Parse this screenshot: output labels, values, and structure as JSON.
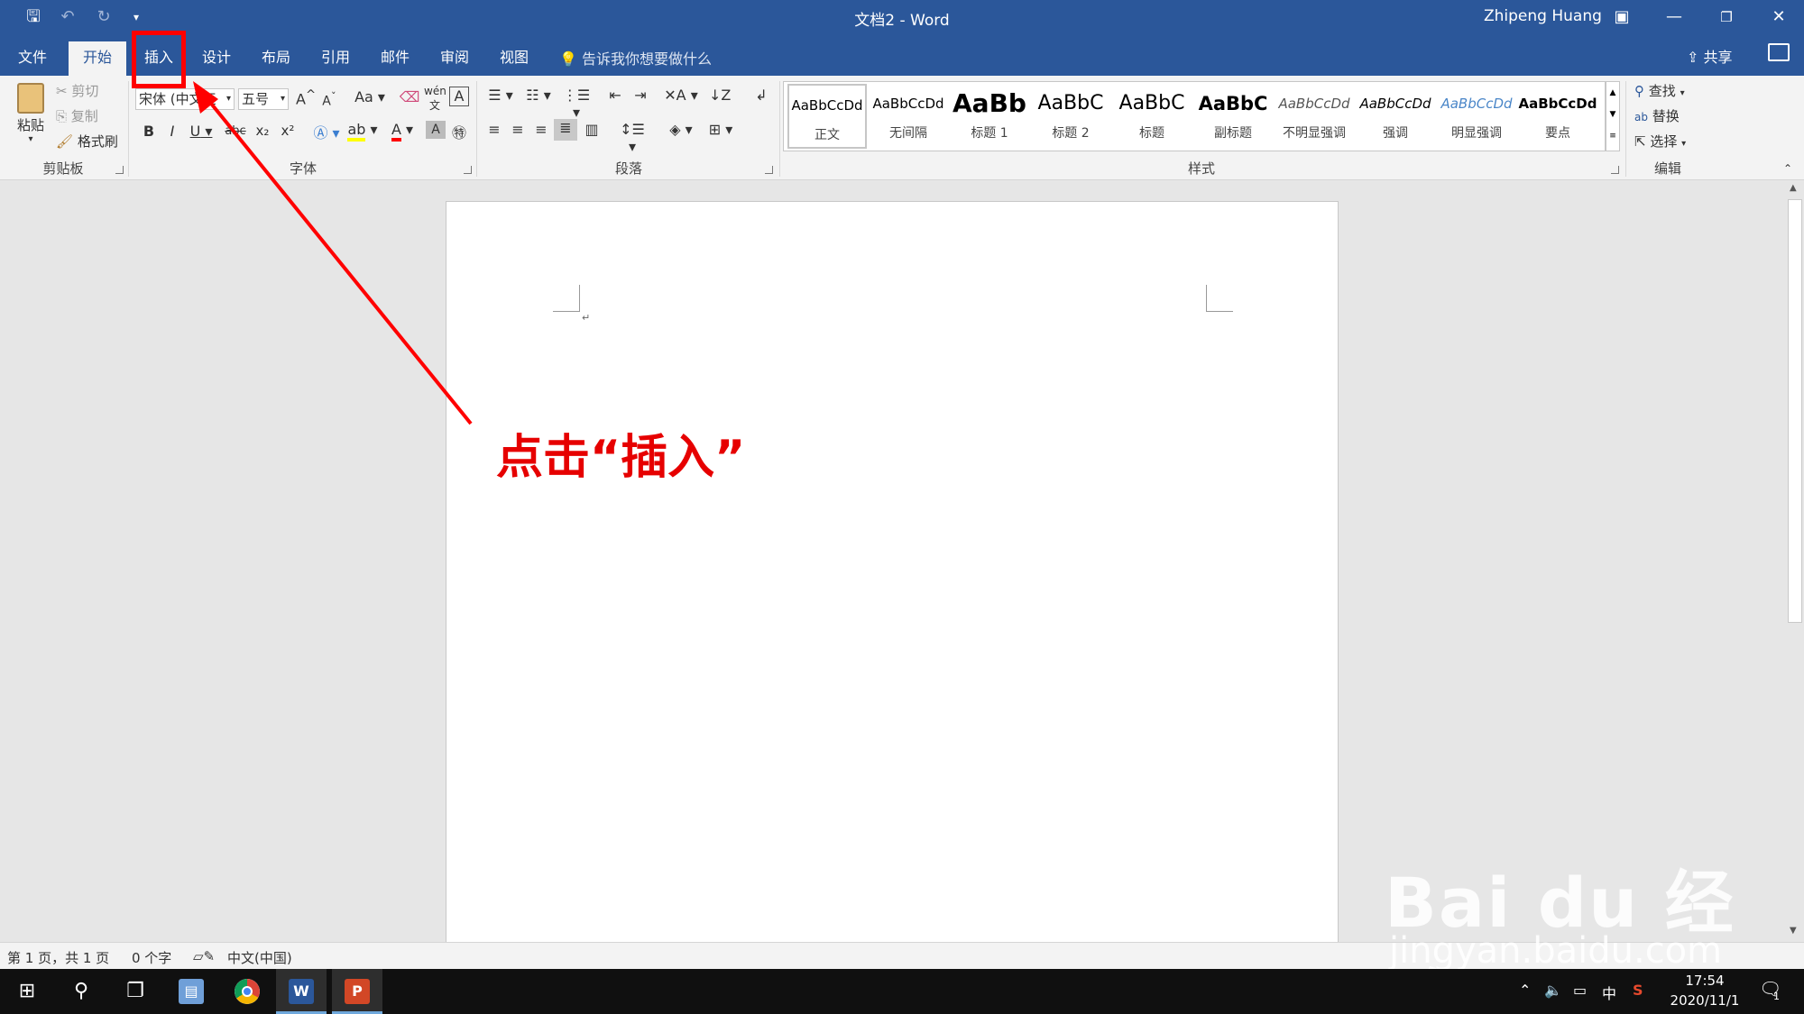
{
  "window": {
    "title": "文档2 - Word",
    "user": "Zhipeng Huang",
    "quick_access": {
      "save_icon": "save-icon",
      "undo_icon": "undo-icon",
      "redo_icon": "redo-icon",
      "customize_icon": "customize-icon"
    }
  },
  "tabs": [
    {
      "label": "文件",
      "active": false
    },
    {
      "label": "开始",
      "active": true
    },
    {
      "label": "插入",
      "active": false
    },
    {
      "label": "设计",
      "active": false
    },
    {
      "label": "布局",
      "active": false
    },
    {
      "label": "引用",
      "active": false
    },
    {
      "label": "邮件",
      "active": false
    },
    {
      "label": "审阅",
      "active": false
    },
    {
      "label": "视图",
      "active": false
    }
  ],
  "tell_me": "告诉我你想要做什么",
  "share": "共享",
  "ribbon": {
    "clipboard": {
      "paste": "粘贴",
      "cut": "剪切",
      "copy": "复制",
      "format_painter": "格式刷",
      "group": "剪贴板"
    },
    "font": {
      "font_name": "宋体 (中文正",
      "font_size": "五号",
      "grow": "A",
      "shrink": "A",
      "change_case": "Aa",
      "bold": "B",
      "italic": "I",
      "underline": "U",
      "strike": "abc",
      "subscript": "x₂",
      "superscript": "x²",
      "group": "字体"
    },
    "paragraph": {
      "group": "段落"
    },
    "styles": {
      "group": "样式",
      "items": [
        {
          "sample": "AaBbCcDd",
          "name": "正文"
        },
        {
          "sample": "AaBbCcDd",
          "name": "无间隔"
        },
        {
          "sample": "AaBb",
          "name": "标题 1"
        },
        {
          "sample": "AaBbC",
          "name": "标题 2"
        },
        {
          "sample": "AaBbC",
          "name": "标题"
        },
        {
          "sample": "AaBbC",
          "name": "副标题"
        },
        {
          "sample": "AaBbCcDd",
          "name": "不明显强调"
        },
        {
          "sample": "AaBbCcDd",
          "name": "强调"
        },
        {
          "sample": "AaBbCcDd",
          "name": "明显强调"
        },
        {
          "sample": "AaBbCcDd",
          "name": "要点"
        }
      ]
    },
    "editing": {
      "find": "查找",
      "replace": "替换",
      "select": "选择",
      "group": "编辑"
    }
  },
  "annotation": {
    "callout": "点击“插入”",
    "color": "#ff0000"
  },
  "status": {
    "page": "第 1 页，共 1 页",
    "words": "0 个字",
    "language": "中文(中国)"
  },
  "watermark": {
    "logo": "Bai du 经验",
    "url": "jingyan.baidu.com"
  },
  "taskbar": {
    "time": "17:54",
    "date": "2020/11/1",
    "ime": "中",
    "notification_count": "1"
  },
  "colors": {
    "word_blue": "#2b579a",
    "ribbon_bg": "#f3f3f3",
    "annotation_red": "#ff0000"
  }
}
